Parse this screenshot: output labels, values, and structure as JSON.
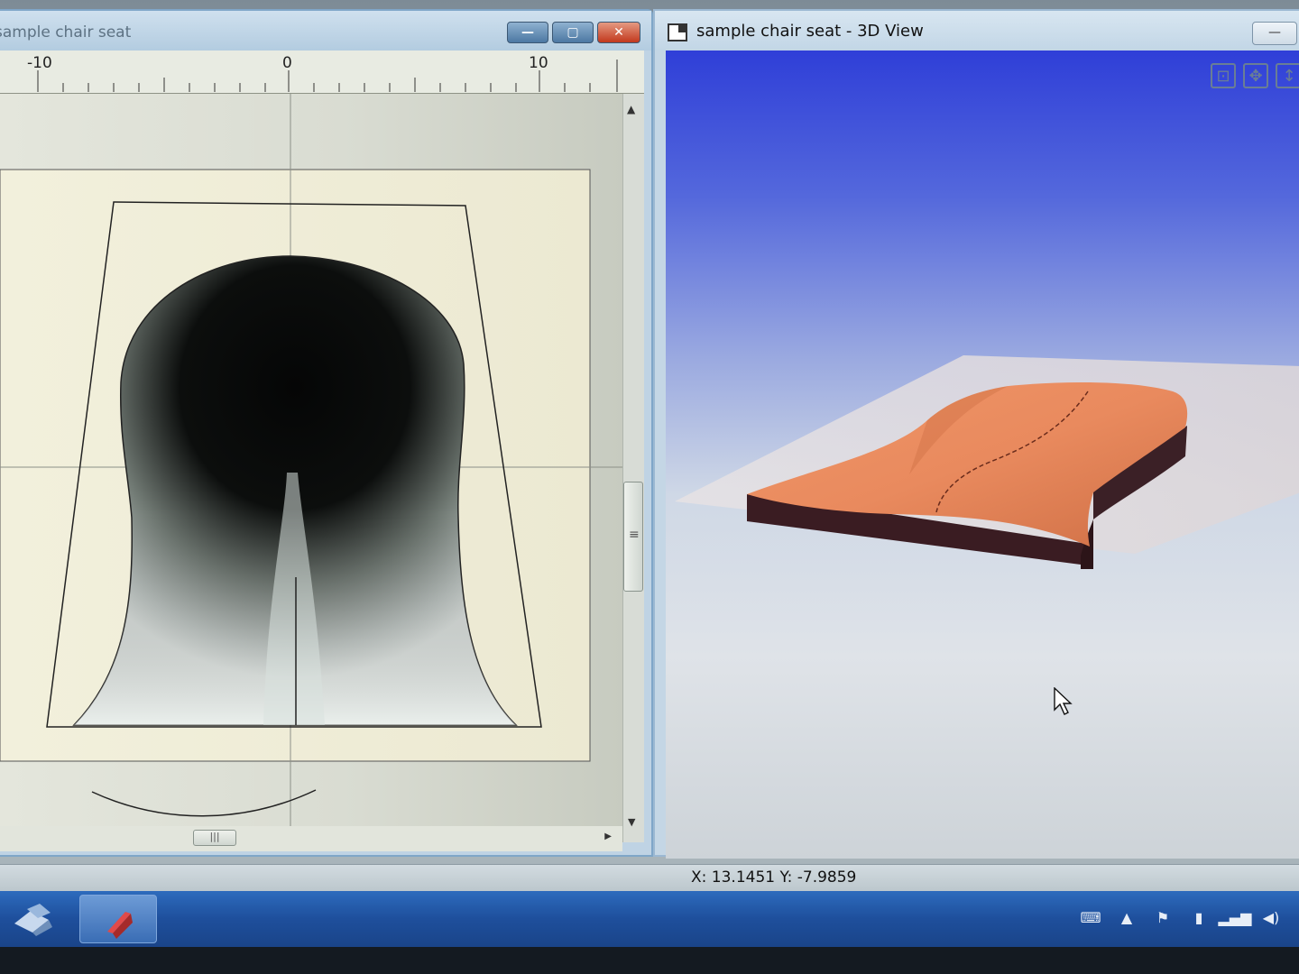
{
  "left_window": {
    "title": "sample chair seat",
    "buttons": {
      "minimize": "—",
      "maximize": "▢",
      "close": "✕"
    },
    "ruler_labels": [
      "-10",
      "0",
      "10"
    ],
    "hscroll_grip": "|||"
  },
  "right_window": {
    "title": "sample chair seat - 3D View",
    "minimize": "—"
  },
  "status": {
    "coords": "X: 13.1451  Y: -7.9859"
  },
  "colors": {
    "seat_top": "#e98a5e",
    "seat_side": "#3a1c22",
    "sky_top": "#2f3fd8"
  },
  "icons": [
    "zoom-extents-icon",
    "rotate-view-icon",
    "pan-view-icon",
    "start-orb-icon",
    "keyboard-icon",
    "tray-chevron-icon",
    "flag-icon",
    "battery-icon",
    "signal-icon",
    "volume-icon"
  ]
}
